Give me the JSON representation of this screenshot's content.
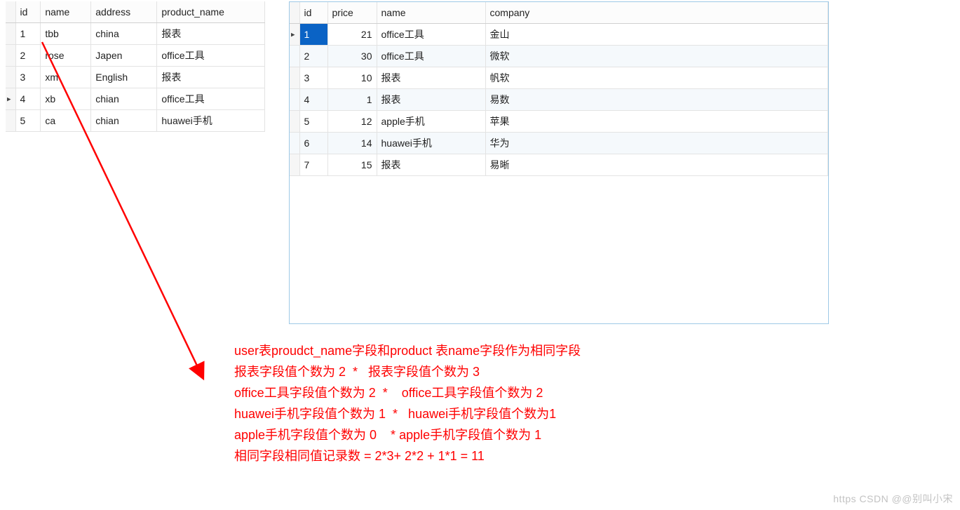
{
  "table1": {
    "headers": [
      "id",
      "name",
      "address",
      "product_name"
    ],
    "rows": [
      {
        "id": "1",
        "name": "tbb",
        "address": "china",
        "product_name": "报表",
        "marker": false
      },
      {
        "id": "2",
        "name": "rose",
        "address": "Japen",
        "product_name": "office工具",
        "marker": false
      },
      {
        "id": "3",
        "name": "xm",
        "address": "English",
        "product_name": "报表",
        "marker": false
      },
      {
        "id": "4",
        "name": "xb",
        "address": "chian",
        "product_name": "office工具",
        "marker": true
      },
      {
        "id": "5",
        "name": "ca",
        "address": "chian",
        "product_name": "huawei手机",
        "marker": false
      }
    ]
  },
  "table2": {
    "headers": [
      "id",
      "price",
      "name",
      "company"
    ],
    "rows": [
      {
        "id": "1",
        "price": "21",
        "name": "office工具",
        "company": "金山",
        "marker": true,
        "selected": true
      },
      {
        "id": "2",
        "price": "30",
        "name": "office工具",
        "company": "微软",
        "marker": false
      },
      {
        "id": "3",
        "price": "10",
        "name": "报表",
        "company": "帆软",
        "marker": false
      },
      {
        "id": "4",
        "price": "1",
        "name": "报表",
        "company": "易数",
        "marker": false
      },
      {
        "id": "5",
        "price": "12",
        "name": "apple手机",
        "company": "苹果",
        "marker": false
      },
      {
        "id": "6",
        "price": "14",
        "name": "huawei手机",
        "company": "华为",
        "marker": false
      },
      {
        "id": "7",
        "price": "15",
        "name": "报表",
        "company": "易晰",
        "marker": false
      }
    ]
  },
  "annotation_lines": [
    "user表proudct_name字段和product 表name字段作为相同字段",
    "报表字段值个数为 2  *   报表字段值个数为 3",
    "office工具字段值个数为 2  *    office工具字段值个数为 2",
    "huawei手机字段值个数为 1  *   huawei手机字段值个数为1",
    "apple手机字段值个数为 0    * apple手机字段值个数为 1",
    "相同字段相同值记录数 = 2*3+ 2*2 + 1*1 = 11"
  ],
  "watermark": "https CSDN @@别叫小宋"
}
